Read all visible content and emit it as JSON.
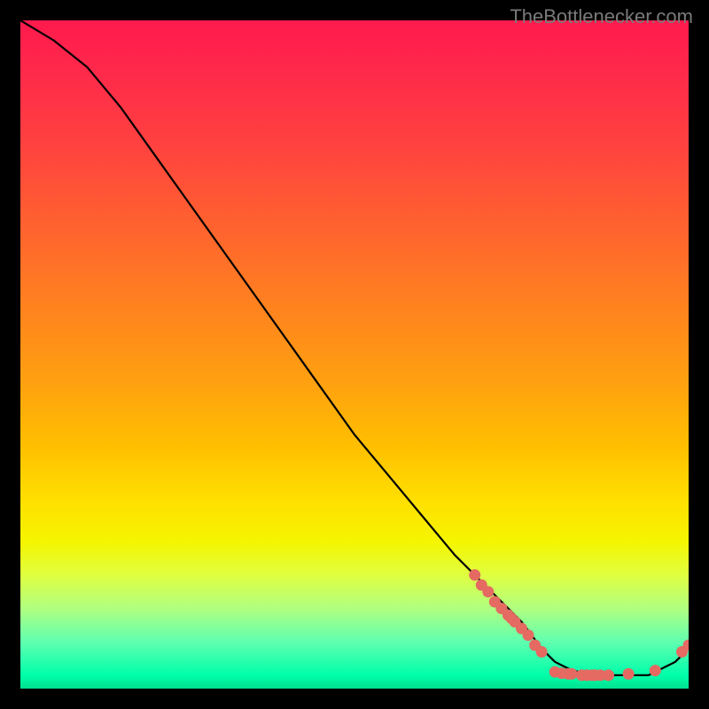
{
  "attribution": "TheBottlenecker.com",
  "chart_data": {
    "type": "line",
    "title": "",
    "xlabel": "",
    "ylabel": "",
    "xlim": [
      0,
      100
    ],
    "ylim": [
      0,
      100
    ],
    "series": [
      {
        "name": "curve",
        "x": [
          0,
          5,
          10,
          15,
          20,
          25,
          30,
          35,
          40,
          45,
          50,
          55,
          60,
          65,
          70,
          75,
          78,
          80,
          82,
          85,
          88,
          90,
          92,
          94,
          96,
          98,
          100
        ],
        "values": [
          100,
          97,
          93,
          87,
          80,
          73,
          66,
          59,
          52,
          45,
          38,
          32,
          26,
          20,
          15,
          10,
          6,
          4,
          3,
          2,
          2,
          2,
          2,
          2,
          3,
          4,
          6
        ]
      }
    ],
    "markers": [
      {
        "x": 68,
        "y": 17
      },
      {
        "x": 69,
        "y": 15.5
      },
      {
        "x": 70,
        "y": 14.5
      },
      {
        "x": 71,
        "y": 13
      },
      {
        "x": 72,
        "y": 12
      },
      {
        "x": 73,
        "y": 11
      },
      {
        "x": 73.5,
        "y": 10.5
      },
      {
        "x": 74,
        "y": 10
      },
      {
        "x": 75,
        "y": 9
      },
      {
        "x": 76,
        "y": 8
      },
      {
        "x": 77,
        "y": 6.5
      },
      {
        "x": 78,
        "y": 5.5
      },
      {
        "x": 80,
        "y": 2.5
      },
      {
        "x": 81,
        "y": 2.3
      },
      {
        "x": 82,
        "y": 2.2
      },
      {
        "x": 82.5,
        "y": 2.2
      },
      {
        "x": 84,
        "y": 2.0
      },
      {
        "x": 84.8,
        "y": 2.0
      },
      {
        "x": 85.5,
        "y": 2.0
      },
      {
        "x": 86,
        "y": 2.0
      },
      {
        "x": 86.8,
        "y": 2.0
      },
      {
        "x": 88,
        "y": 2.0
      },
      {
        "x": 91,
        "y": 2.2
      },
      {
        "x": 95,
        "y": 2.7
      },
      {
        "x": 99,
        "y": 5.5
      },
      {
        "x": 100,
        "y": 6.5
      }
    ],
    "gradient_stops": [
      {
        "pos": 0,
        "color": "#ff1a4d"
      },
      {
        "pos": 50,
        "color": "#ffc000"
      },
      {
        "pos": 100,
        "color": "#00e090"
      }
    ]
  }
}
